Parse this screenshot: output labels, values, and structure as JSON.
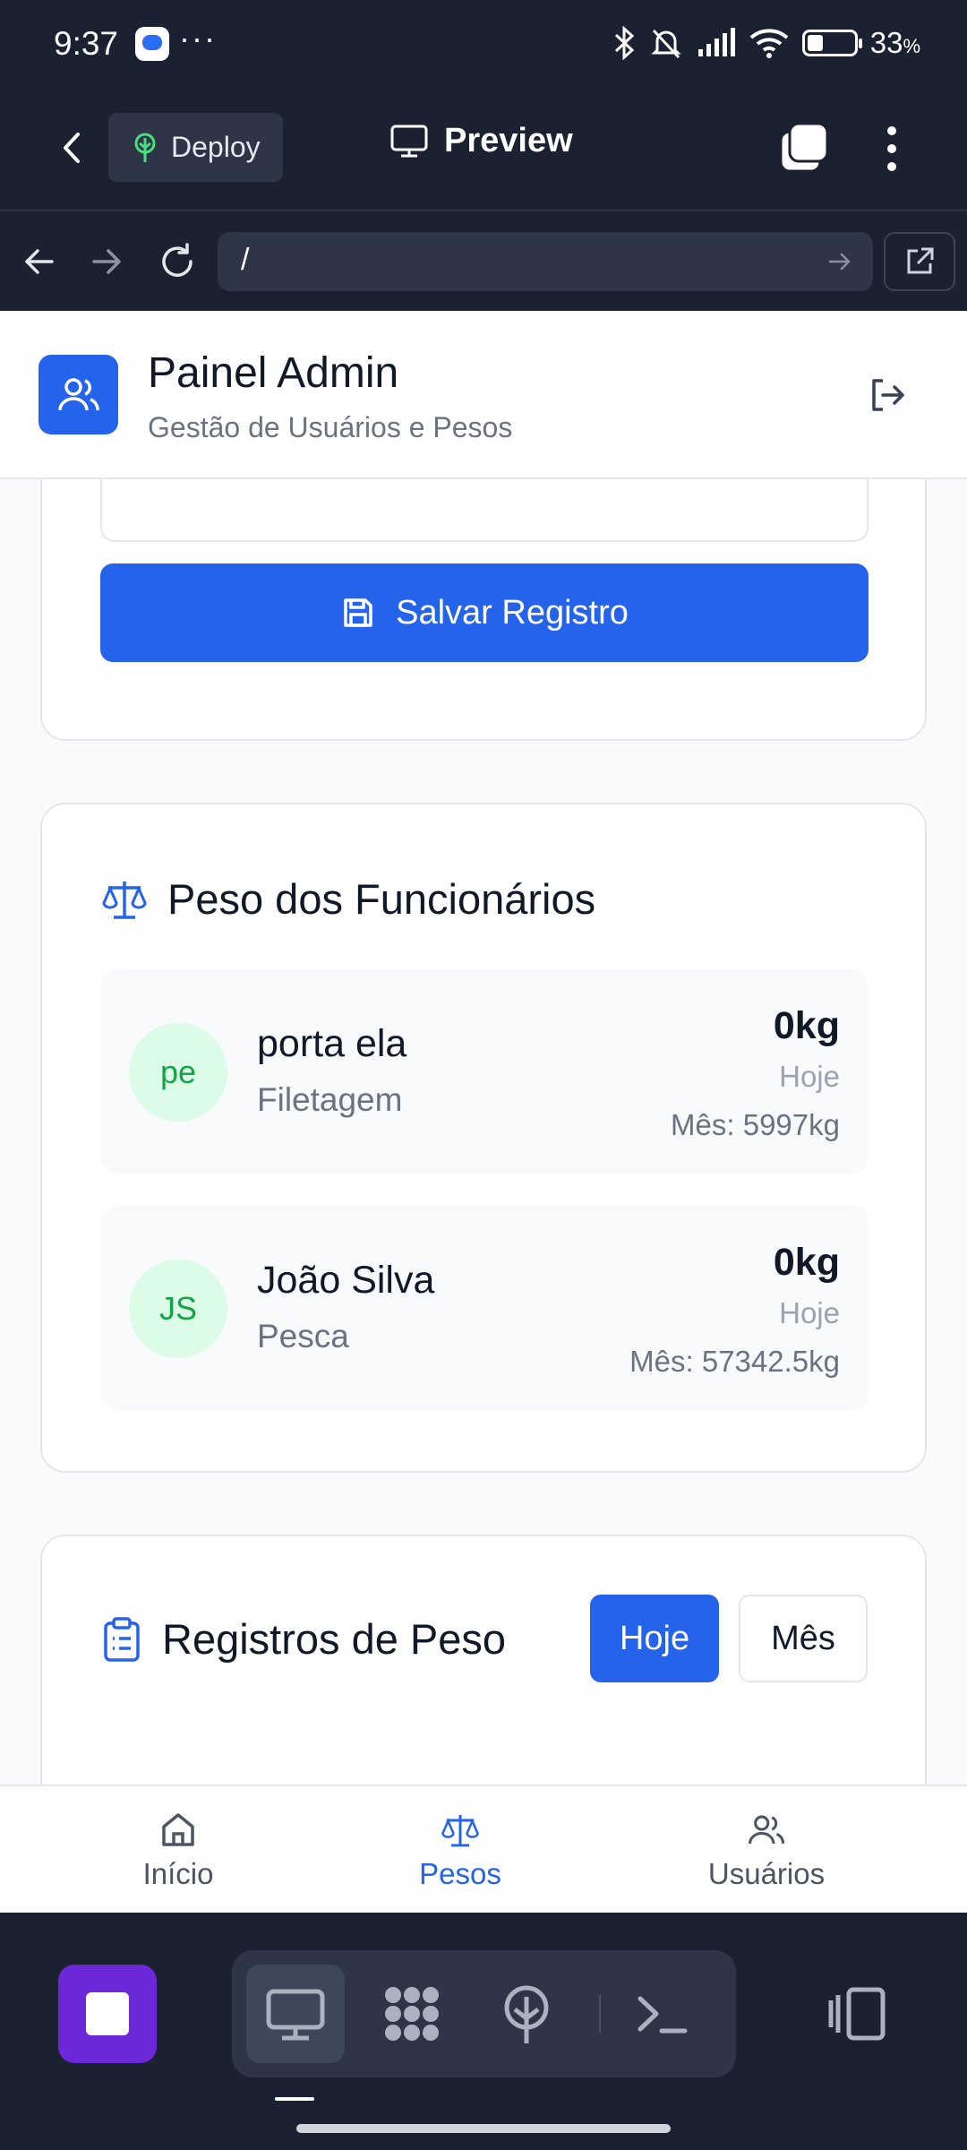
{
  "status_bar": {
    "time": "9:37",
    "dots": "···",
    "battery": "33",
    "battery_unit": "%"
  },
  "app_bar": {
    "deploy_label": "Deploy",
    "preview_label": "Preview"
  },
  "url_bar": {
    "url": "/"
  },
  "header": {
    "title": "Painel Admin",
    "subtitle": "Gestão de Usuários e Pesos"
  },
  "form": {
    "save_label": "Salvar Registro"
  },
  "employees_section": {
    "title": "Peso dos Funcionários",
    "items": [
      {
        "initials": "pe",
        "name": "porta ela",
        "role": "Filetagem",
        "today_kg": "0kg",
        "today_label": "Hoje",
        "month": "Mês: 5997kg"
      },
      {
        "initials": "JS",
        "name": "João Silva",
        "role": "Pesca",
        "today_kg": "0kg",
        "today_label": "Hoje",
        "month": "Mês: 57342.5kg"
      }
    ]
  },
  "records_section": {
    "title": "Registros de Peso",
    "filter_today": "Hoje",
    "filter_month": "Mês"
  },
  "bottom_nav": {
    "items": [
      {
        "label": "Início",
        "icon": "home-icon"
      },
      {
        "label": "Pesos",
        "icon": "scale-icon",
        "active": true
      },
      {
        "label": "Usuários",
        "icon": "users-icon"
      }
    ]
  },
  "colors": {
    "primary": "#2563eb",
    "avatar_bg": "#dcfce7",
    "avatar_text": "#16a34a",
    "dark_chrome": "#1b2130",
    "stop": "#6d28d9"
  }
}
